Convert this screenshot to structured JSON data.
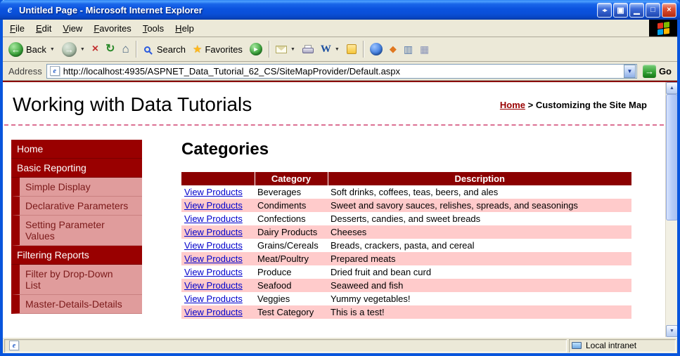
{
  "window": {
    "title": "Untitled Page - Microsoft Internet Explorer"
  },
  "menu": {
    "items": [
      "File",
      "Edit",
      "View",
      "Favorites",
      "Tools",
      "Help"
    ]
  },
  "toolbar": {
    "back_label": "Back",
    "search_label": "Search",
    "favorites_label": "Favorites"
  },
  "address": {
    "label": "Address",
    "url": "http://localhost:4935/ASPNET_Data_Tutorial_62_CS/SiteMapProvider/Default.aspx",
    "go_label": "Go"
  },
  "page": {
    "header_title": "Working with Data Tutorials",
    "breadcrumb": {
      "home": "Home",
      "separator": ">",
      "current": "Customizing the Site Map"
    },
    "sidebar": [
      {
        "label": "Home",
        "level": 1
      },
      {
        "label": "Basic Reporting",
        "level": 1
      },
      {
        "label": "Simple Display",
        "level": 2
      },
      {
        "label": "Declarative Parameters",
        "level": 2
      },
      {
        "label": "Setting Parameter Values",
        "level": 2
      },
      {
        "label": "Filtering Reports",
        "level": 1
      },
      {
        "label": "Filter by Drop-Down List",
        "level": 2
      },
      {
        "label": "Master-Details-Details",
        "level": 2
      }
    ],
    "main": {
      "heading": "Categories",
      "table": {
        "headers": [
          "",
          "Category",
          "Description"
        ],
        "link_label": "View Products",
        "rows": [
          [
            "Beverages",
            "Soft drinks, coffees, teas, beers, and ales"
          ],
          [
            "Condiments",
            "Sweet and savory sauces, relishes, spreads, and seasonings"
          ],
          [
            "Confections",
            "Desserts, candies, and sweet breads"
          ],
          [
            "Dairy Products",
            "Cheeses"
          ],
          [
            "Grains/Cereals",
            "Breads, crackers, pasta, and cereal"
          ],
          [
            "Meat/Poultry",
            "Prepared meats"
          ],
          [
            "Produce",
            "Dried fruit and bean curd"
          ],
          [
            "Seafood",
            "Seaweed and fish"
          ],
          [
            "Veggies",
            "Yummy vegetables!"
          ],
          [
            "Test Category",
            "This is a test!"
          ]
        ]
      }
    }
  },
  "statusbar": {
    "zone": "Local intranet"
  },
  "icons": {
    "ie_e": "e",
    "back": "←",
    "forward": "→",
    "chevron_down": "▼",
    "stop": "×",
    "refresh": "↻",
    "home": "⌂",
    "star": "★",
    "play": "▸",
    "word": "W",
    "go": "→",
    "combo_arrow": "▼",
    "scroll_up": "▲",
    "scroll_down": "▼",
    "arrows": "◂▸",
    "screen": "▣",
    "minimize": "▁",
    "maximize": "□",
    "close": "×",
    "diamond": "◆",
    "shield": "▥",
    "grid": "▦"
  },
  "colors": {
    "window_border": "#0855DD",
    "face": "#ECE9D8",
    "maroon": "#990000",
    "table_header": "#8B0000",
    "salmon": "#E09C9C",
    "row_pink": "#FFCBCB",
    "link_blue": "#0000CC",
    "dashed_pink": "#DB7093",
    "go_green": "#2F9E2F"
  }
}
